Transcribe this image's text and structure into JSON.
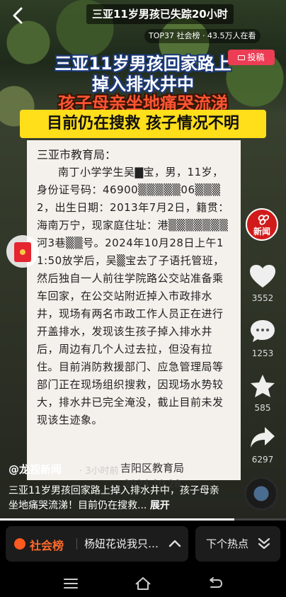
{
  "header": {
    "title": "三亚11岁男孩已失踪20小时",
    "rank_text": "TOP37 社会榜 · 43.5万人在看",
    "submit_label": "投稿"
  },
  "video": {
    "headline_line1": "三亚11岁男孩回家路上",
    "headline_line2": "掉入排水井中",
    "headline_line3": "孩子母亲坐地痛哭流涕",
    "headline_banner": "目前仍在搜救 孩子情况不明",
    "doc_heading": "三亚市教育局：",
    "doc_body": "南丁小学学生吴▇宝，男，11岁，身份证号码：46900▒▒▒▒▒06▒▒▒2，出生日期：2013年7月2日，籍贯：海南万宁，现家庭住址：港▒▒▒▒▒▒▒河3巷▒▒号。2024年10月28日上午11:50放学后，吴▒宝去了子语托管班，然后独自一人前往学院路公交站准备乘车回家，在公交站附近掉入市政排水井，现场有两名市政工作人员正在进行开盖排水，发现该生孩子掉入排水井后，周边有几个人过去拉，但没有拉住。目前消防救援部门、应急管理局等部门正在现场组织搜救，因现场水势较大，排水井已完全淹没，截止目前未发现该生迹象。",
    "doc_signature": "吉阳区教育局",
    "doc_date": "2024.10.28"
  },
  "rail": {
    "channel_logo_text": "新闻",
    "likes": "3552",
    "comments": "1253",
    "favorites": "585",
    "shares": "6297"
  },
  "post": {
    "author": "@龙视新闻",
    "time_ago": "· 3小时前",
    "caption": "三亚11岁男孩回家路上掉入排水井中，孩子母亲坐地痛哭流涕！目前仍在搜救...",
    "expand_label": "展开",
    "progress": 0.82
  },
  "bottom": {
    "hot_label": "社会榜",
    "hot_text": "杨妞花说我只…",
    "next_label": "下个热点"
  },
  "colors": {
    "accent_red": "#ec3d55",
    "banner_yellow": "#ffde1a",
    "hot_orange": "#ff6a2c"
  }
}
